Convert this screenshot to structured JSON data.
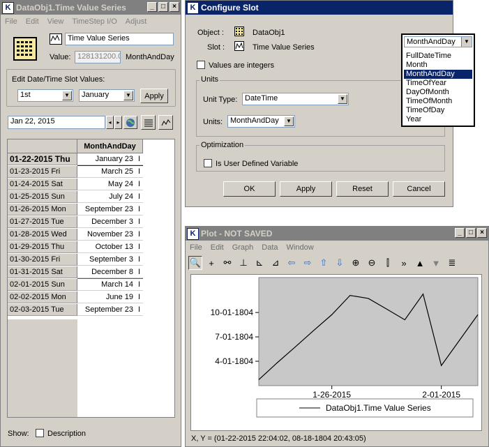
{
  "left_window": {
    "title": "DataObj1.Time Value Series",
    "menu": [
      "File",
      "Edit",
      "View",
      "TimeStep I/O",
      "Adjust"
    ],
    "slot_name": "Time Value Series",
    "value_label": "Value:",
    "value": "128131200.0",
    "value_unit": "MonthAndDay",
    "edit_group_label": "Edit Date/Time Slot Values:",
    "day_select": "1st",
    "month_select": "January",
    "apply_label": "Apply",
    "date_field": "Jan 22, 2015",
    "column_header": "MonthAndDay",
    "rows": [
      {
        "date": "01-22-2015 Thu",
        "value": "January 23",
        "flag": "I"
      },
      {
        "date": "01-23-2015 Fri",
        "value": "March 25",
        "flag": "I"
      },
      {
        "date": "01-24-2015 Sat",
        "value": "May 24",
        "flag": "I"
      },
      {
        "date": "01-25-2015 Sun",
        "value": "July 24",
        "flag": "I"
      },
      {
        "date": "01-26-2015 Mon",
        "value": "September 23",
        "flag": "I"
      },
      {
        "date": "01-27-2015 Tue",
        "value": "December 3",
        "flag": "I"
      },
      {
        "date": "01-28-2015 Wed",
        "value": "November 23",
        "flag": "I"
      },
      {
        "date": "01-29-2015 Thu",
        "value": "October 13",
        "flag": "I"
      },
      {
        "date": "01-30-2015 Fri",
        "value": "September 3",
        "flag": "I"
      },
      {
        "date": "01-31-2015 Sat",
        "value": "December 8",
        "flag": "I"
      },
      {
        "date": "02-01-2015 Sun",
        "value": "March 14",
        "flag": "I"
      },
      {
        "date": "02-02-2015 Mon",
        "value": "June 19",
        "flag": "I"
      },
      {
        "date": "02-03-2015 Tue",
        "value": "September 23",
        "flag": "I"
      }
    ],
    "show_label": "Show:",
    "description_label": "Description"
  },
  "configure_window": {
    "title": "Configure Slot",
    "object_label": "Object :",
    "object_value": "DataObj1",
    "slot_label": "Slot :",
    "slot_value": "Time Value Series",
    "integers_label": "Values are integers",
    "units_group": "Units",
    "unit_type_label": "Unit Type:",
    "unit_type_value": "DateTime",
    "units_label": "Units:",
    "units_value": "MonthAndDay",
    "optimization_group": "Optimization",
    "user_defined_label": "Is User Defined Variable",
    "buttons": {
      "ok": "OK",
      "apply": "Apply",
      "reset": "Reset",
      "cancel": "Cancel"
    }
  },
  "dropdown": {
    "selected": "MonthAndDay",
    "options": [
      "FullDateTime",
      "Month",
      "MonthAndDay",
      "TimeOfYear",
      "DayOfMonth",
      "TimeOfMonth",
      "TimeOfDay",
      "Year"
    ]
  },
  "plot_window": {
    "title": "Plot - NOT SAVED",
    "menu": [
      "File",
      "Edit",
      "Graph",
      "Data",
      "Window"
    ],
    "status": "X, Y = (01-22-2015 22:04:02, 08-18-1804 20:43:05)"
  },
  "chart_data": {
    "type": "line",
    "x": [
      "01-22-2015",
      "01-23-2015",
      "01-24-2015",
      "01-25-2015",
      "01-26-2015",
      "01-27-2015",
      "01-28-2015",
      "01-29-2015",
      "01-30-2015",
      "01-31-2015",
      "02-01-2015",
      "02-02-2015",
      "02-03-2015"
    ],
    "y_tick_labels": [
      "4-01-1804",
      "7-01-1804",
      "10-01-1804"
    ],
    "x_tick_labels": [
      "1-26-2015",
      "2-01-2015"
    ],
    "y_values_months": [
      0.73,
      2.8,
      4.77,
      6.77,
      8.73,
      11.1,
      10.73,
      9.43,
      8.1,
      11.27,
      2.47,
      5.6,
      8.73
    ],
    "ylim_months": [
      0,
      13.3
    ],
    "series": [
      {
        "name": "DataObj1.Time Value Series"
      }
    ],
    "legend_position": "bottom",
    "grid": false
  }
}
